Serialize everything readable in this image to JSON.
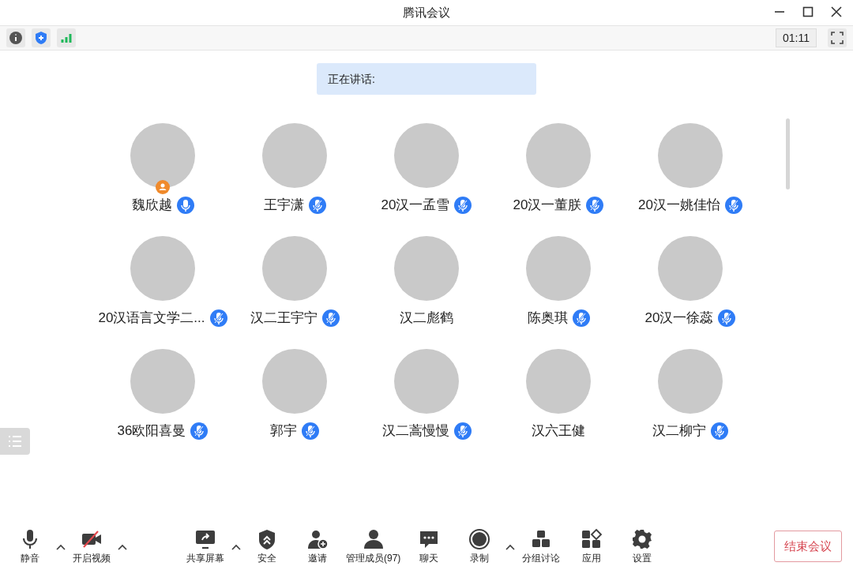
{
  "window": {
    "title": "腾讯会议"
  },
  "info_bar": {
    "timer": "01:11"
  },
  "speaking": {
    "label": "正在讲话:"
  },
  "participants": [
    {
      "name": "魏欣越",
      "mic": true,
      "muted": false,
      "host": true
    },
    {
      "name": "王宇潇",
      "mic": true,
      "muted": true,
      "host": false
    },
    {
      "name": "20汉一孟雪",
      "mic": true,
      "muted": true,
      "host": false
    },
    {
      "name": "20汉一董朕",
      "mic": true,
      "muted": true,
      "host": false
    },
    {
      "name": "20汉一姚佳怡",
      "mic": true,
      "muted": true,
      "host": false
    },
    {
      "name": "20汉语言文学二...",
      "mic": true,
      "muted": true,
      "host": false
    },
    {
      "name": "汉二王宇宁",
      "mic": true,
      "muted": true,
      "host": false
    },
    {
      "name": "汉二彪鹤",
      "mic": false,
      "host": false
    },
    {
      "name": "陈奥琪",
      "mic": true,
      "muted": true,
      "host": false
    },
    {
      "name": "20汉一徐蕊",
      "mic": true,
      "muted": true,
      "host": false
    },
    {
      "name": "36欧阳喜曼",
      "mic": true,
      "muted": true,
      "host": false
    },
    {
      "name": "郭宇",
      "mic": true,
      "muted": true,
      "host": false
    },
    {
      "name": "汉二蒿慢慢",
      "mic": true,
      "muted": true,
      "host": false
    },
    {
      "name": "汉六王健",
      "mic": false,
      "host": false
    },
    {
      "name": "汉二柳宁",
      "mic": true,
      "muted": true,
      "host": false
    }
  ],
  "toolbar": [
    {
      "kind": "mic",
      "label": "静音",
      "menu": true
    },
    {
      "kind": "camera",
      "label": "开启视频",
      "menu": true
    },
    {
      "kind": "share",
      "label": "共享屏幕",
      "menu": true
    },
    {
      "kind": "security",
      "label": "安全",
      "menu": false
    },
    {
      "kind": "invite",
      "label": "邀请",
      "menu": false
    },
    {
      "kind": "members",
      "label": "管理成员(97)",
      "menu": false
    },
    {
      "kind": "chat",
      "label": "聊天",
      "menu": false
    },
    {
      "kind": "record",
      "label": "录制",
      "menu": true
    },
    {
      "kind": "group",
      "label": "分组讨论",
      "menu": false
    },
    {
      "kind": "apps",
      "label": "应用",
      "menu": false
    },
    {
      "kind": "settings",
      "label": "设置",
      "menu": false
    }
  ],
  "end_button": {
    "label": "结束会议"
  }
}
